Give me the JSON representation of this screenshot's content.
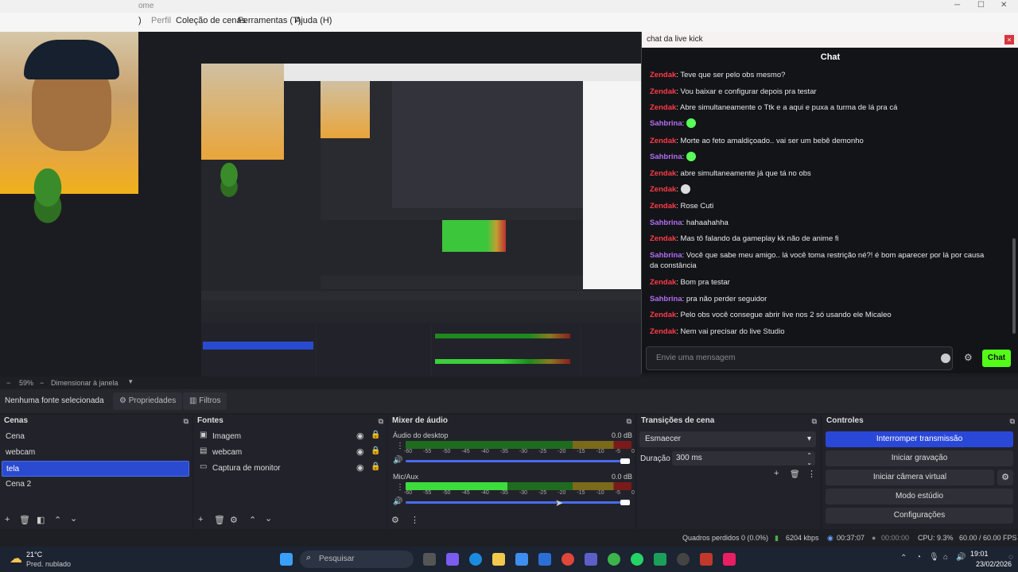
{
  "window": {
    "title": "ome"
  },
  "menu": [
    {
      "label": ")"
    },
    {
      "label": "Perfil"
    },
    {
      "label": "Coleção de cenas"
    },
    {
      "label": "Ferramentas (T)"
    },
    {
      "label": "Ajuda (H)"
    }
  ],
  "chat": {
    "window_title": "chat  da live kick",
    "title": "Chat",
    "messages": [
      {
        "user": "Zendak",
        "text": ": Teve que ser pelo obs mesmo?"
      },
      {
        "user": "Zendak",
        "text": ": Vou baixar e configurar depois pra testar"
      },
      {
        "user": "Zendak",
        "text": ": Abre simultaneamente o Ttk e a aqui e puxa a turma de lá pra cá"
      },
      {
        "user": "Sahbrina",
        "text": ": "
      },
      {
        "user": "Zendak",
        "text": ": Morte ao feto amaldiçoado.. vai ser um bebê demonho"
      },
      {
        "user": "Sahbrina",
        "text": ": "
      },
      {
        "user": "Zendak",
        "text": ": abre simultaneamente já que tá no obs"
      },
      {
        "user": "Zendak",
        "text": ": "
      },
      {
        "user": "Zendak",
        "text": ": Rose Cuti"
      },
      {
        "user": "Sahbrina",
        "text": ": hahaahahha"
      },
      {
        "user": "Zendak",
        "text": ": Mas tô falando da gameplay kk não de anime fi"
      },
      {
        "user": "Sahbrina",
        "text": ": Você que sabe meu amigo.. lá você toma restrição né?! é bom aparecer por lá por causa da constância"
      },
      {
        "user": "Zendak",
        "text": ": Bom pra testar"
      },
      {
        "user": "Sahbrina",
        "text": ": pra não perder seguidor"
      },
      {
        "user": "Zendak",
        "text": ": Pelo obs você consegue abrir live nos 2 só usando ele Micaleo"
      },
      {
        "user": "Zendak",
        "text": ": Nem vai precisar do live Studio"
      }
    ],
    "input_placeholder": "Envie uma mensagem",
    "send_label": "Chat",
    "colors": {
      "zendak": "#ff3b47",
      "sahbrina": "#b26df2",
      "send": "#53fc18"
    }
  },
  "zoom": {
    "value": "59%",
    "mode": "Dimensionar à janela"
  },
  "properties_bar": {
    "no_source": "Nenhuma fonte selecionada",
    "properties": "Propriedades",
    "filters": "Filtros"
  },
  "scenes": {
    "title": "Cenas",
    "items": [
      "Cena",
      "webcam",
      "tela",
      "Cena 2"
    ],
    "selected": "tela"
  },
  "sources": {
    "title": "Fontes",
    "items": [
      "Imagem",
      "webcam",
      "Captura de monitor"
    ]
  },
  "mixer": {
    "title": "Mixer de áudio",
    "channels": [
      {
        "name": "Áudio do desktop",
        "db": "0.0 dB",
        "level": 0.0
      },
      {
        "name": "Mic/Aux",
        "db": "0.0 dB",
        "level": 0.45
      }
    ],
    "ticks": [
      "-60",
      "-55",
      "-50",
      "-45",
      "-40",
      "-35",
      "-30",
      "-25",
      "-20",
      "-15",
      "-10",
      "-5",
      "0"
    ]
  },
  "transitions": {
    "title": "Transições de cena",
    "selected": "Esmaecer",
    "duration_label": "Duração",
    "duration_value": "300 ms"
  },
  "controls": {
    "title": "Controles",
    "buttons": [
      "Interromper transmissão",
      "Iniciar gravação",
      "Iniciar câmera virtual",
      "Modo estúdio",
      "Configurações"
    ]
  },
  "status": {
    "dropped": "Quadros perdidos 0 (0.0%)",
    "bitrate": "6204 kbps",
    "live_time": "00:37:07",
    "rec_time": "00:00:00",
    "cpu": "CPU: 9.3%",
    "fps": "60.00 / 60.00 FPS"
  },
  "taskbar": {
    "weather_temp": "21°C",
    "weather_desc": "Pred. nublado",
    "search": "Pesquisar",
    "time": "19:01",
    "date": "23/02/2026"
  }
}
